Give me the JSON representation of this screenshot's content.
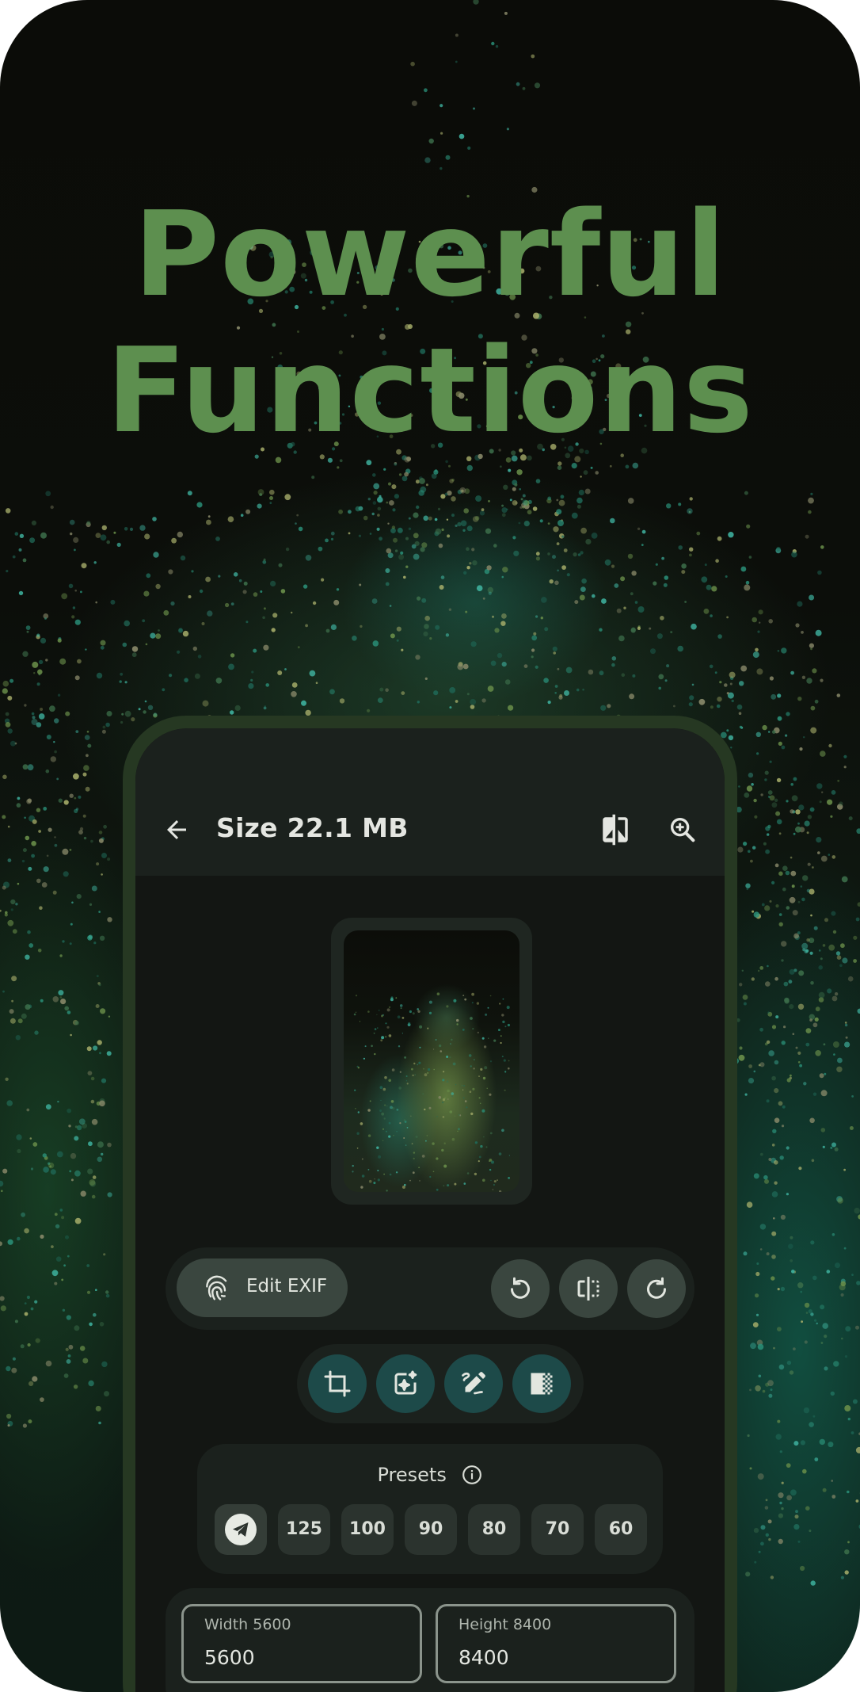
{
  "colors": {
    "headline": "#5d8f4f",
    "phone_frame": "#263822",
    "screen_bg": "#131613",
    "surface": "#1b211d",
    "tonal_button": "#3a463f",
    "teal_button": "#1d4a49",
    "outline": "#8b948c"
  },
  "headline": {
    "line1": "Powerful",
    "line2": "Functions"
  },
  "app": {
    "toolbar": {
      "back_icon": "arrow-back-icon",
      "title": "Size 22.1 MB",
      "compare_icon": "compare-icon",
      "zoom_icon": "zoom-in-icon"
    },
    "preview_icon": "image-preview",
    "actions": {
      "edit_exif_label": "Edit EXIF",
      "edit_exif_icon": "fingerprint-icon",
      "rotate_left_icon": "rotate-left-icon",
      "flip_icon": "flip-icon",
      "rotate_right_icon": "rotate-right-icon"
    },
    "tools": [
      "crop-icon",
      "auto-filter-icon",
      "draw-icon",
      "erase-background-icon"
    ],
    "presets": {
      "title": "Presets",
      "info_icon": "info-icon",
      "selected_icon": "telegram-icon",
      "values": [
        "125",
        "100",
        "90",
        "80",
        "70",
        "60"
      ]
    },
    "dimensions": {
      "width_label": "Width 5600",
      "width_value": "5600",
      "height_label": "Height 8400",
      "height_value": "8400"
    }
  }
}
